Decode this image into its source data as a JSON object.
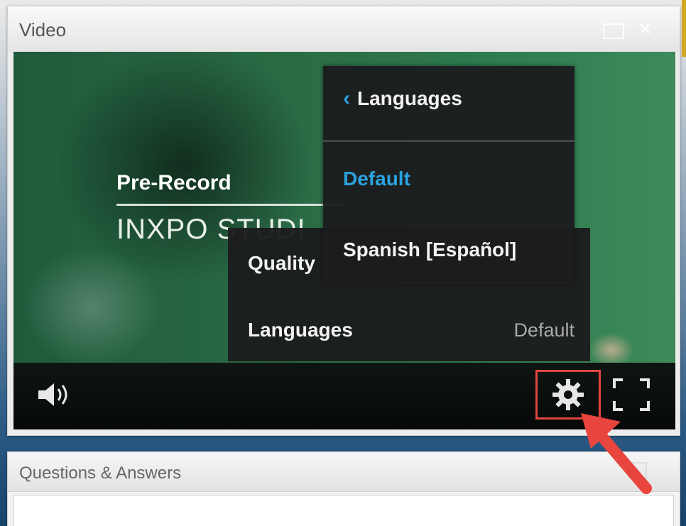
{
  "video_panel": {
    "title": "Video"
  },
  "player": {
    "overlay": {
      "title": "Pre-Record",
      "brand": "INXPO STUDI"
    },
    "controls": {
      "volume_icon": "volume-icon",
      "settings_icon": "gear-icon",
      "fullscreen_icon": "fullscreen-icon"
    }
  },
  "settings_menu": {
    "items": [
      {
        "label": "Quality",
        "value": ""
      },
      {
        "label": "Languages",
        "value": "Default"
      }
    ]
  },
  "languages_menu": {
    "header": "Languages",
    "back_icon": "chevron-left-icon",
    "options": [
      {
        "label": "Default",
        "selected": true
      },
      {
        "label": "Spanish [Español]",
        "selected": false
      }
    ]
  },
  "qa_panel": {
    "title": "Questions & Answers"
  },
  "colors": {
    "accent": "#2aa3e0",
    "highlight_box": "#e0463f",
    "annotation_arrow": "#e8453e"
  }
}
